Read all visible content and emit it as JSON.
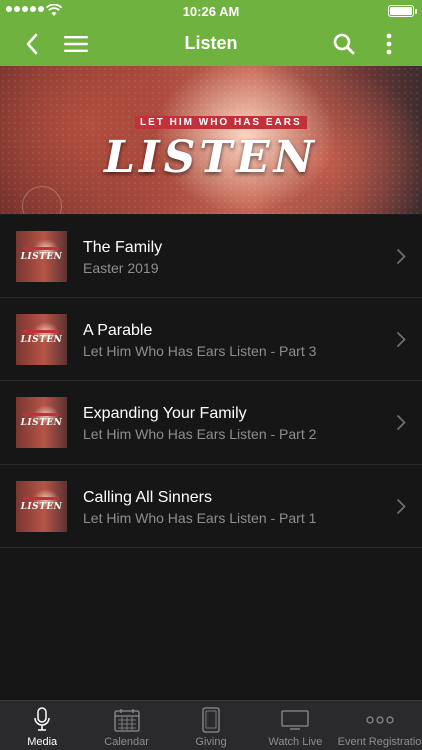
{
  "status_bar": {
    "time": "10:26 AM"
  },
  "nav": {
    "title": "Listen"
  },
  "hero": {
    "tagline": "LET HIM WHO HAS EARS",
    "word": "LISTEN"
  },
  "thumb_word": "LISTEN",
  "items": [
    {
      "title": "The Family",
      "subtitle": "Easter 2019"
    },
    {
      "title": "A Parable",
      "subtitle": "Let Him Who Has Ears Listen - Part 3"
    },
    {
      "title": "Expanding Your Family",
      "subtitle": "Let Him Who Has Ears Listen - Part 2"
    },
    {
      "title": "Calling All Sinners",
      "subtitle": "Let Him Who Has Ears Listen - Part 1"
    }
  ],
  "tabs": [
    {
      "label": "Media",
      "icon": "microphone-icon",
      "active": true
    },
    {
      "label": "Calendar",
      "icon": "calendar-icon",
      "active": false
    },
    {
      "label": "Giving",
      "icon": "tablet-icon",
      "active": false
    },
    {
      "label": "Watch Live",
      "icon": "tv-icon",
      "active": false
    },
    {
      "label": "Event Registration",
      "icon": "more-dots-icon",
      "active": false
    }
  ],
  "colors": {
    "accent": "#6fb23f",
    "background": "#161617",
    "tabbar": "#2a2a2c",
    "secondary_text": "#8e8e93",
    "banner_red": "#c0313a"
  }
}
